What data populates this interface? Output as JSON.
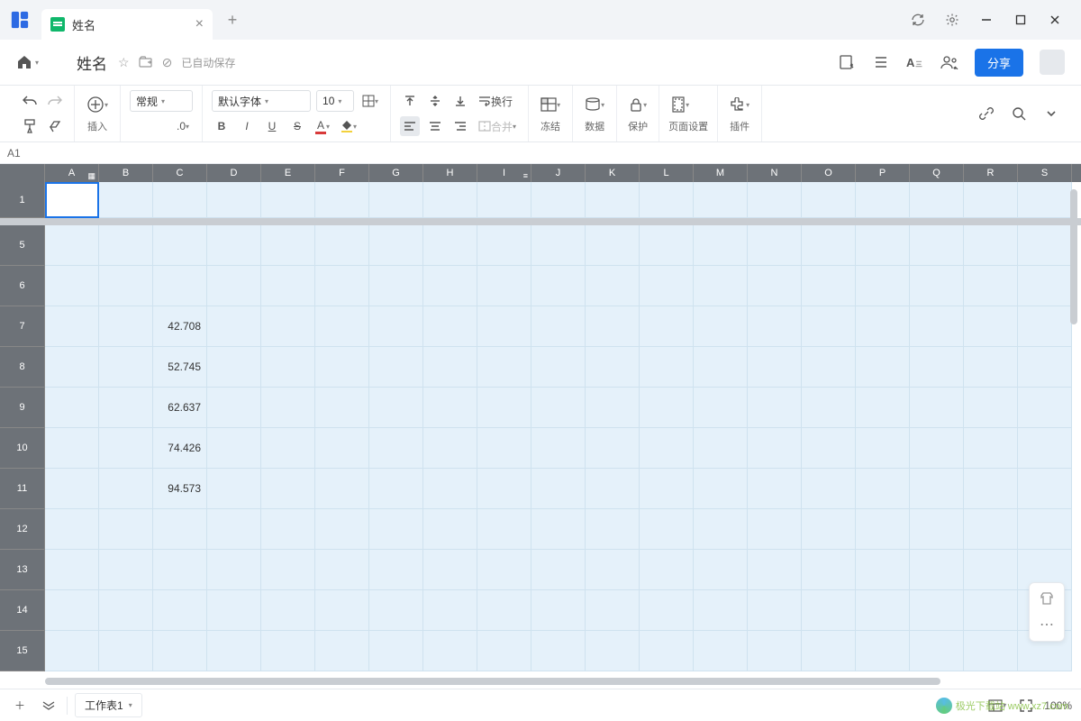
{
  "titlebar": {
    "tab_title": "姓名"
  },
  "doc": {
    "title": "姓名",
    "saved": "已自动保存"
  },
  "header": {
    "share": "分享"
  },
  "toolbar": {
    "insert": "插入",
    "format_general": "常规",
    "decimal": ".0",
    "font": "默认字体",
    "font_size": "10",
    "wrap": "换行",
    "merge": "合并",
    "freeze": "冻结",
    "data": "数据",
    "protect": "保护",
    "page_setup": "页面设置",
    "plugins": "插件"
  },
  "name_box": "A1",
  "columns": [
    "A",
    "B",
    "C",
    "D",
    "E",
    "F",
    "G",
    "H",
    "I",
    "J",
    "K",
    "L",
    "M",
    "N",
    "O",
    "P",
    "Q",
    "R",
    "S"
  ],
  "visible_rows": [
    "1",
    "5",
    "6",
    "7",
    "8",
    "9",
    "10",
    "11",
    "12",
    "13",
    "14",
    "15"
  ],
  "cells": {
    "C7": "42.708",
    "C8": "52.745",
    "C9": "62.637",
    "C10": "74.426",
    "C11": "94.573"
  },
  "status": {
    "sheet": "工作表1",
    "zoom": "100%"
  },
  "watermark": "极光下载站  www.xz7.com"
}
